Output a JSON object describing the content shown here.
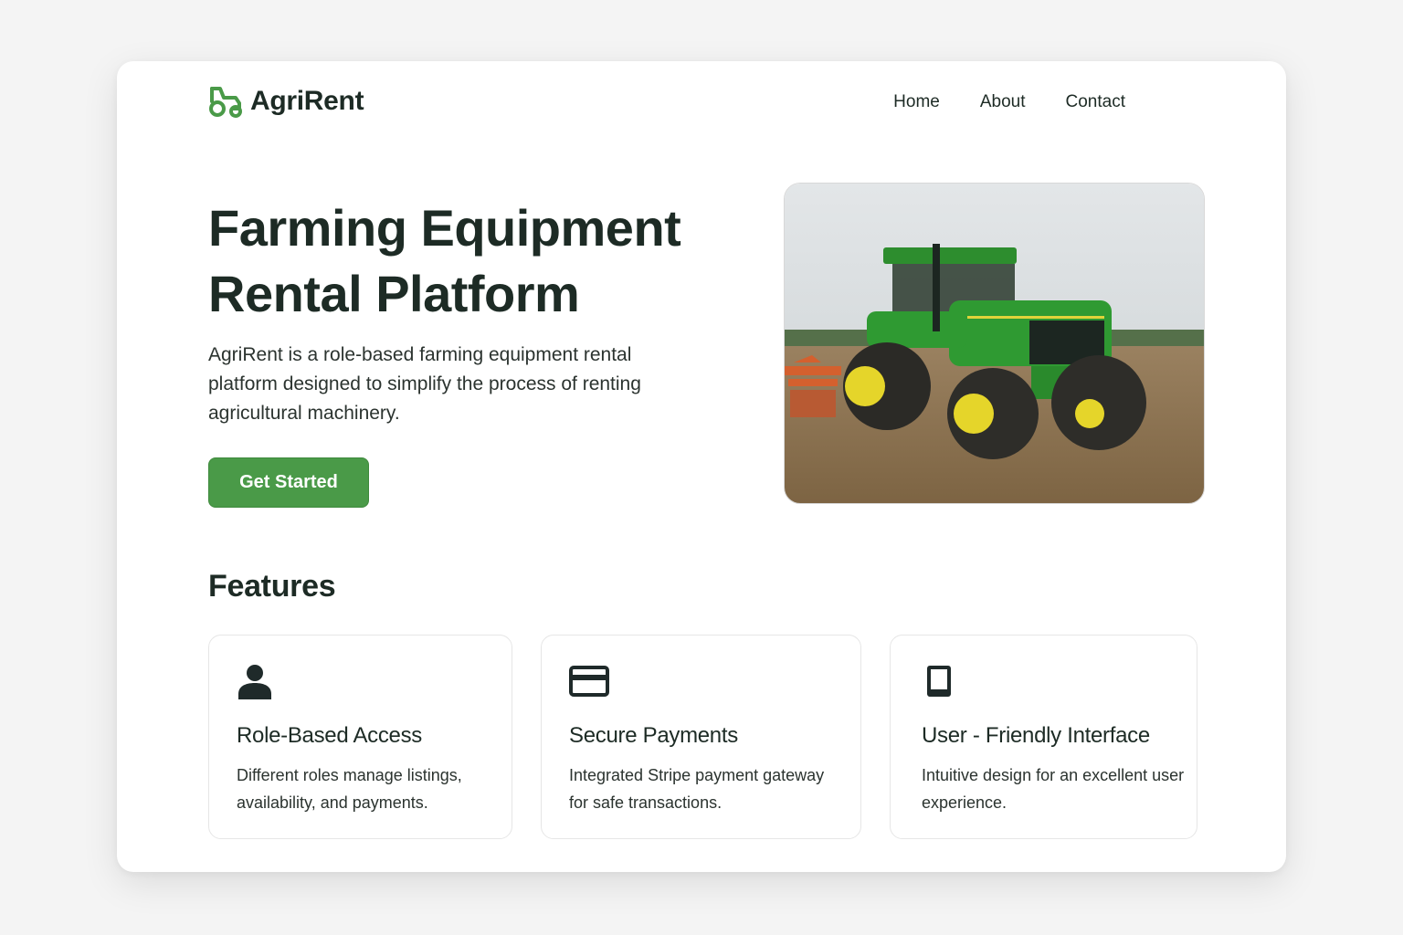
{
  "brand": {
    "name": "AgriRent",
    "accent": "#4a9a48"
  },
  "nav": [
    "Home",
    "About",
    "Contact"
  ],
  "hero": {
    "title": "Farming Equipment Rental Platform",
    "description": "AgriRent is a role-based farming equipment  rental platform designed to simplify the process of renting agricultural machinery.",
    "cta": "Get Started"
  },
  "features": {
    "title": "Features",
    "items": [
      {
        "icon": "user-icon",
        "title": "Role-Based Access",
        "description": "Different roles manage listings, availability, and payments."
      },
      {
        "icon": "credit-card-icon",
        "title": "Secure Payments",
        "description": "Integrated Stripe payment gateway for safe transactions."
      },
      {
        "icon": "tablet-icon",
        "title": "User - Friendly Interface",
        "description": "Intuitive design for an excellent user experience."
      }
    ]
  }
}
